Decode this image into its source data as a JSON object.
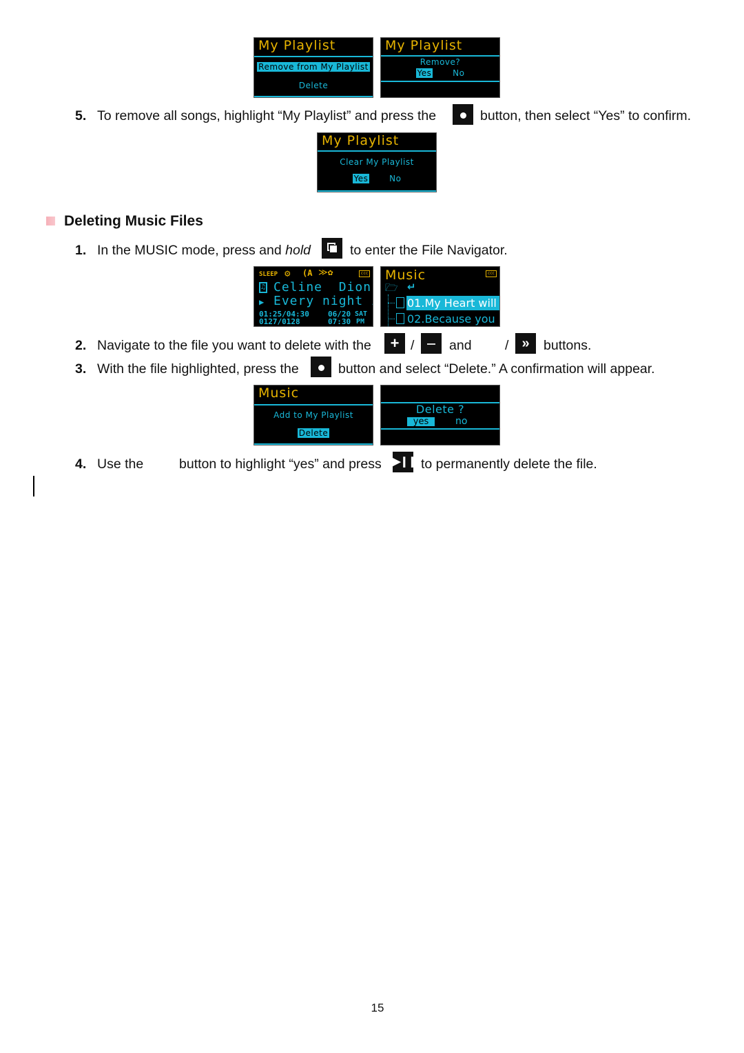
{
  "screens": {
    "playlist_menu": {
      "title": "My Playlist",
      "options": [
        "Remove from My Playlist",
        "Delete"
      ],
      "highlighted": "Remove from My Playlist"
    },
    "playlist_remove_confirm": {
      "title": "My Playlist",
      "prompt": "Remove?",
      "yes": "Yes",
      "no": "No"
    },
    "playlist_clear_confirm": {
      "title": "My Playlist",
      "prompt": "Clear My Playlist",
      "yes": "Yes",
      "no": "No"
    },
    "now_playing": {
      "status_sleep": "SLEEP",
      "artist": "Celine  Dion",
      "song": "Every night in",
      "elapsed_total": "01:25/04:30",
      "track_count": "0127/0128",
      "date": "06/20",
      "day": "SAT",
      "time": "07:30",
      "ampm": "PM"
    },
    "file_navigator": {
      "title": "Music",
      "files": [
        "01.My Heart will",
        "02.Because you"
      ],
      "highlighted_index": 0
    },
    "music_menu": {
      "title": "Music",
      "options": [
        "Add to My Playlist",
        "Delete"
      ],
      "highlighted": "Delete"
    },
    "delete_confirm": {
      "prompt": "Delete ?",
      "yes": "yes",
      "no": "no"
    }
  },
  "steps_top": {
    "step5": {
      "number": "5.",
      "text_before": "To remove all songs, highlight “My Playlist” and press the",
      "text_after": "button, then select “Yes” to confirm.",
      "icon": "select-button-icon"
    }
  },
  "section": {
    "title": "Deleting Music Files",
    "steps": [
      {
        "number": "1.",
        "text_before": "In the MUSIC mode, press and",
        "text_italic": "hold",
        "text_after": "to enter the File Navigator.",
        "icon": "navigator-button-icon"
      },
      {
        "number": "2.",
        "text_before": "Navigate to the file you want to delete with the",
        "sep1": "/",
        "text_and": "and",
        "sep2": "/",
        "text_after": "buttons.",
        "icons": [
          "plus-button-icon",
          "minus-button-icon",
          "fast-forward-button-icon"
        ]
      },
      {
        "number": "3.",
        "text_before": "With the file highlighted, press the",
        "text_after": "button and select “Delete.” A confirmation will appear.",
        "icon": "select-button-icon"
      },
      {
        "number": "4.",
        "text_before": "Use the",
        "text_middle": "button to highlight “yes” and press",
        "text_after": "to permanently delete the file.",
        "icon": "play-pause-button-icon"
      }
    ]
  },
  "page_number": "15"
}
